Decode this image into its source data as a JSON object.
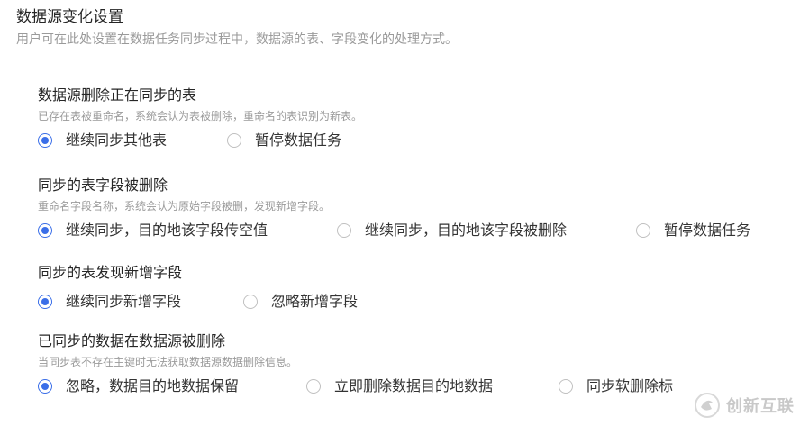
{
  "header": {
    "title": "数据源变化设置",
    "subtitle": "用户可在此处设置在数据任务同步过程中，数据源的表、字段变化的处理方式。"
  },
  "sections": [
    {
      "title": "数据源删除正在同步的表",
      "desc": "已存在表被重命名，系统会认为表被删除，重命名的表识别为新表。",
      "options": [
        {
          "label": "继续同步其他表",
          "selected": true
        },
        {
          "label": "暂停数据任务",
          "selected": false
        }
      ]
    },
    {
      "title": "同步的表字段被删除",
      "desc": "重命名字段名称，系统会认为原始字段被删，发现新增字段。",
      "options": [
        {
          "label": "继续同步，目的地该字段传空值",
          "selected": true
        },
        {
          "label": "继续同步，目的地该字段被删除",
          "selected": false
        },
        {
          "label": "暂停数据任务",
          "selected": false
        }
      ]
    },
    {
      "title": "同步的表发现新增字段",
      "options": [
        {
          "label": "继续同步新增字段",
          "selected": true
        },
        {
          "label": "忽略新增字段",
          "selected": false
        }
      ]
    },
    {
      "title": "已同步的数据在数据源被删除",
      "desc": "当同步表不存在主键时无法获取数据源数据删除信息。",
      "options": [
        {
          "label": "忽略，数据目的地数据保留",
          "selected": true
        },
        {
          "label": "立即删除数据目的地数据",
          "selected": false
        },
        {
          "label": "同步软删除标",
          "selected": false
        }
      ]
    }
  ],
  "watermark": {
    "text": "创新互联",
    "color": "#cfcfcf",
    "icon": "brand-logo-icon"
  },
  "colors": {
    "accent": "#3a6ee8",
    "title": "#262626",
    "muted": "#9a9a9a"
  }
}
